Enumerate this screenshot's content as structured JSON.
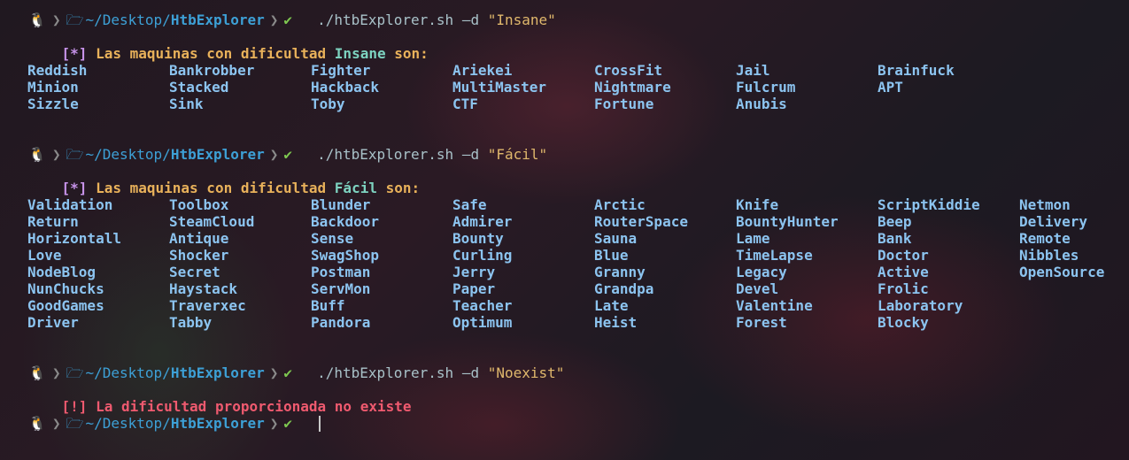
{
  "prompt": {
    "path_prefix": "~/Desktop/",
    "path_dir": "HtbExplorer",
    "os_icon": "linux-penguin-icon",
    "folder_icon": "folder-icon",
    "check": "✔"
  },
  "blocks": {
    "insane": {
      "cmd": "./htbExplorer.sh –d ",
      "arg": "\"Insane\"",
      "tag": "[*]",
      "msg": "Las maquinas con dificultad ",
      "level": "Insane",
      "suffix": " son:",
      "columns": [
        [
          "Reddish",
          "Minion",
          "Sizzle"
        ],
        [
          "Bankrobber",
          "Stacked",
          "Sink"
        ],
        [
          "Fighter",
          "Hackback",
          "Toby"
        ],
        [
          "Ariekei",
          "MultiMaster",
          "CTF"
        ],
        [
          "CrossFit",
          "Nightmare",
          "Fortune"
        ],
        [
          "Jail",
          "Fulcrum",
          "Anubis"
        ],
        [
          "Brainfuck",
          "APT"
        ]
      ]
    },
    "easy": {
      "cmd": "./htbExplorer.sh –d ",
      "arg": "\"Fácil\"",
      "tag": "[*]",
      "msg": "Las maquinas con dificultad ",
      "level": "Fácil",
      "suffix": " son:",
      "columns": [
        [
          "Validation",
          "Return",
          "Horizontall",
          "Love",
          "NodeBlog",
          "NunChucks",
          "GoodGames",
          "Driver"
        ],
        [
          "Toolbox",
          "SteamCloud",
          "Antique",
          "Shocker",
          "Secret",
          "Haystack",
          "Traverxec",
          "Tabby"
        ],
        [
          "Blunder",
          "Backdoor",
          "Sense",
          "SwagShop",
          "Postman",
          "ServMon",
          "Buff",
          "Pandora"
        ],
        [
          "Safe",
          "Admirer",
          "Bounty",
          "Curling",
          "Jerry",
          "Paper",
          "Teacher",
          "Optimum"
        ],
        [
          "Arctic",
          "RouterSpace",
          "Sauna",
          "Blue",
          "Granny",
          "Grandpa",
          "Late",
          "Heist"
        ],
        [
          "Knife",
          "BountyHunter",
          "Lame",
          "TimeLapse",
          "Legacy",
          "Devel",
          "Valentine",
          "Forest"
        ],
        [
          "ScriptKiddie",
          "Beep",
          "Bank",
          "Doctor",
          "Active",
          "Frolic",
          "Laboratory",
          "Blocky"
        ],
        [
          "Netmon",
          "Delivery",
          "Remote",
          "Nibbles",
          "OpenSource"
        ]
      ]
    },
    "noexist": {
      "cmd": "./htbExplorer.sh –d ",
      "arg": "\"Noexist\"",
      "tag": "[!]",
      "msg": "La dificultad proporcionada no existe"
    }
  }
}
